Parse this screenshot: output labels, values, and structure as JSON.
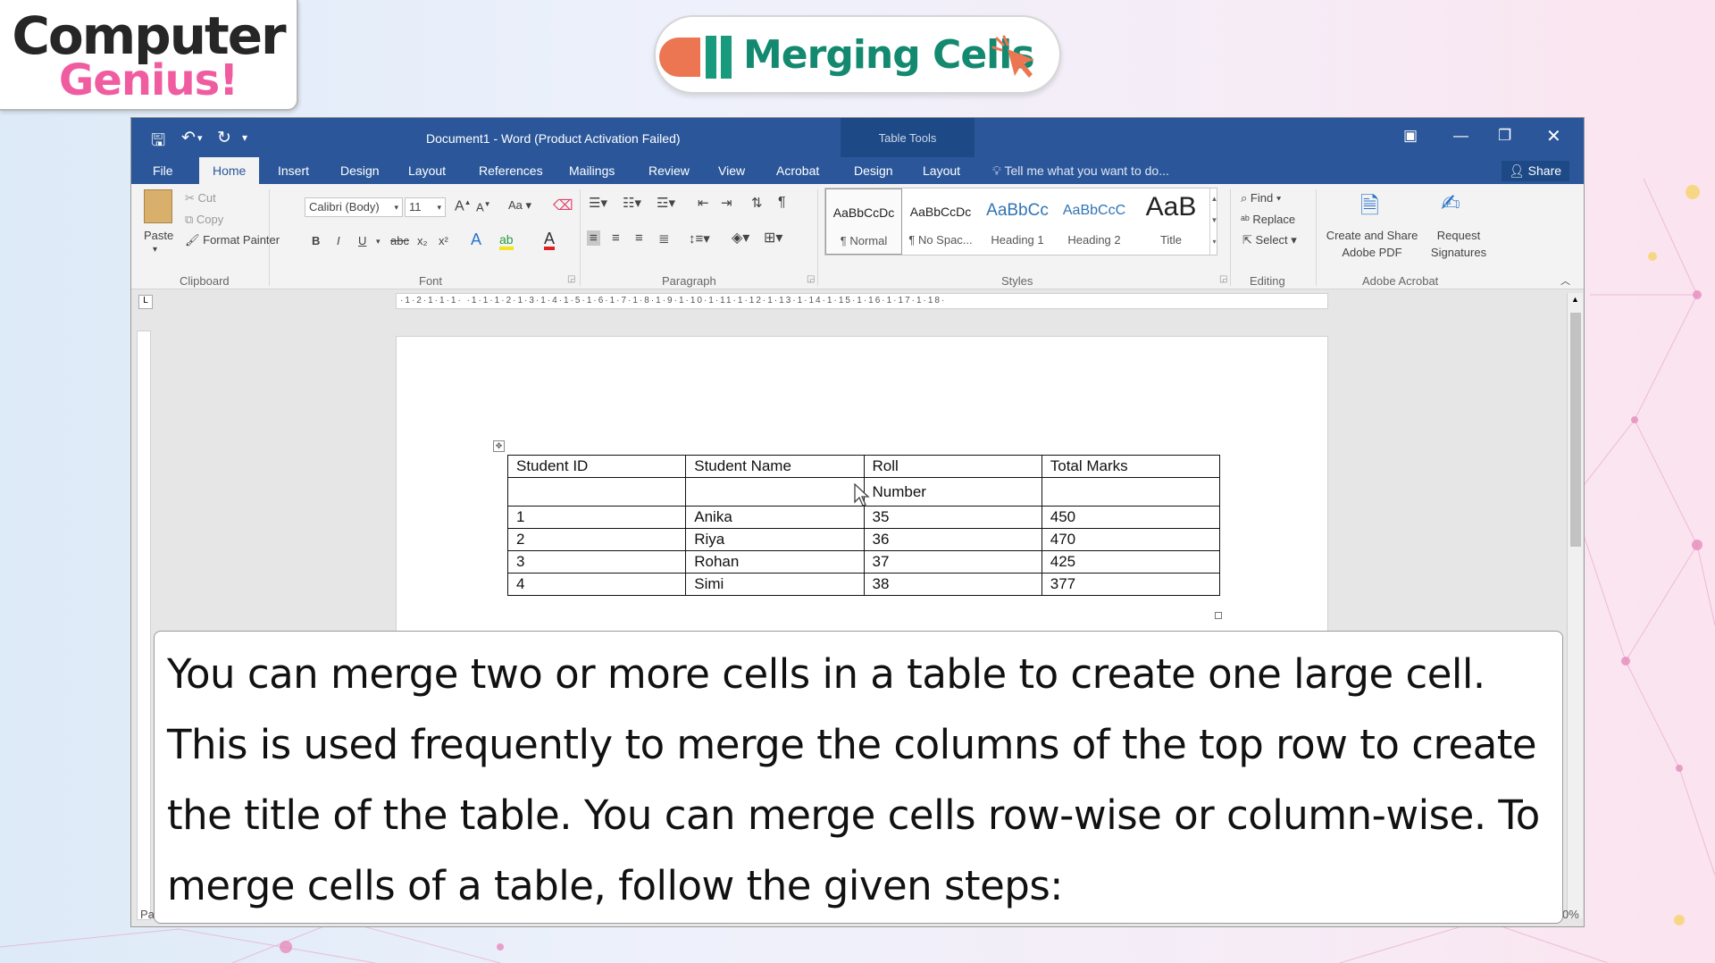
{
  "logo": {
    "line1": "Computer",
    "line2": "Genius!"
  },
  "banner": {
    "title": "Merging Cells"
  },
  "word": {
    "title": "Document1 - Word (Product Activation Failed)",
    "table_tools": "Table Tools",
    "tabs": [
      "File",
      "Home",
      "Insert",
      "Design",
      "Layout",
      "References",
      "Mailings",
      "Review",
      "View",
      "Acrobat",
      "Design",
      "Layout"
    ],
    "tell_me": "Tell me what you want to do...",
    "share": "Share",
    "clipboard": {
      "paste": "Paste",
      "cut": "Cut",
      "copy": "Copy",
      "format_painter": "Format Painter",
      "group": "Clipboard"
    },
    "font": {
      "name": "Calibri (Body)",
      "size": "11",
      "group": "Font",
      "bold": "B",
      "italic": "I",
      "underline": "U",
      "strike": "abc",
      "sub": "x₂",
      "sup": "x²",
      "case": "Aa"
    },
    "paragraph": {
      "group": "Paragraph"
    },
    "styles": {
      "group": "Styles",
      "items": [
        {
          "preview": "AaBbCcDc",
          "name": "¶ Normal"
        },
        {
          "preview": "AaBbCcDc",
          "name": "¶ No Spac..."
        },
        {
          "preview": "AaBbCc",
          "name": "Heading 1"
        },
        {
          "preview": "AaBbCcC",
          "name": "Heading 2"
        },
        {
          "preview": "AaB",
          "name": "Title"
        }
      ]
    },
    "editing": {
      "find": "Find",
      "replace": "Replace",
      "select": "Select",
      "group": "Editing"
    },
    "acrobat": {
      "create_line1": "Create and Share",
      "create_line2": "Adobe PDF",
      "request_line1": "Request",
      "request_line2": "Signatures",
      "group": "Adobe Acrobat"
    },
    "ruler_text": "·1·2·1·1·1·   ·1·1·1·2·1·3·1·4·1·5·1·6·1·7·1·8·1·9·1·10·1·11·1·12·1·13·1·14·1·15·1·16·1·17·1·18·",
    "table": {
      "rows": [
        [
          "Student ID",
          "Student Name",
          "Roll",
          "Total Marks"
        ],
        [
          "",
          "",
          "Number",
          ""
        ],
        [
          "1",
          "Anika",
          "35",
          "450"
        ],
        [
          "2",
          "Riya",
          "36",
          "470"
        ],
        [
          "3",
          "Rohan",
          "37",
          "425"
        ],
        [
          "4",
          "Simi",
          "38",
          "377"
        ]
      ]
    },
    "status_left": "Pa",
    "status_right": "0%"
  },
  "caption": {
    "text": "You can merge two or more cells in a table to create one large cell. This is used frequently to merge the columns of the top row to create the title of the table. You can merge cells row-wise or column-wise. To merge cells of a table, follow the given steps:"
  }
}
